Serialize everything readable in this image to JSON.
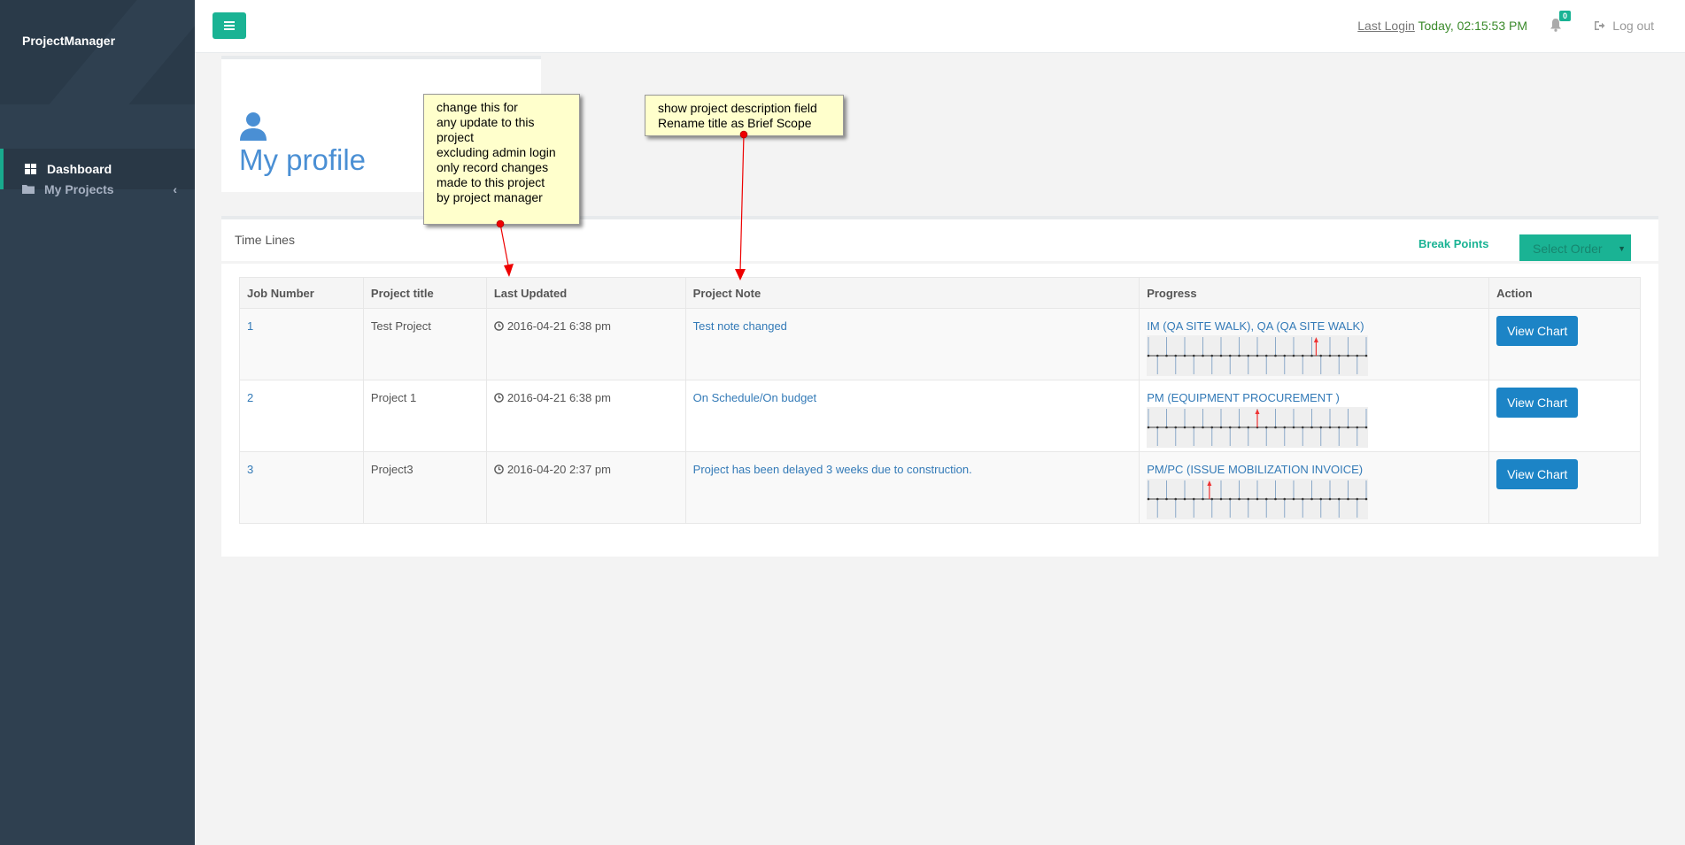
{
  "app": {
    "brand": "ProjectManager"
  },
  "sidebar": {
    "items": [
      {
        "label": "Dashboard",
        "icon": "dashboard-icon",
        "active": true
      },
      {
        "label": "My Projects",
        "icon": "folder-icon",
        "active": false
      }
    ],
    "collapse_icon": "chevron-left-icon"
  },
  "topbar": {
    "menu_icon": "hamburger-icon",
    "last_login_label": "Last Login",
    "last_login_value": "Today, 02:15:53 PM",
    "notification_count": "0",
    "logout_label": "Log out"
  },
  "profile": {
    "title": "My profile",
    "icon": "user-icon"
  },
  "timelines": {
    "title": "Time Lines",
    "break_points_label": "Break Points",
    "select_order_label": "Select Order",
    "columns": [
      "Job Number",
      "Project title",
      "Last Updated",
      "Project Note",
      "Progress",
      "Action"
    ],
    "rows": [
      {
        "job": "1",
        "title": "Test Project",
        "updated": "2016-04-21 6:38 pm",
        "note": "Test note changed",
        "progress": "IM (QA SITE WALK), QA (QA SITE WALK)",
        "action": "View Chart",
        "marker": 0.77
      },
      {
        "job": "2",
        "title": "Project 1",
        "updated": "2016-04-21 6:38 pm",
        "note": "On Schedule/On budget",
        "progress": "PM (EQUIPMENT PROCUREMENT )",
        "action": "View Chart",
        "marker": 0.5
      },
      {
        "job": "3",
        "title": "Project3",
        "updated": "2016-04-20 2:37 pm",
        "note": "Project has been delayed 3 weeks due to construction.",
        "progress": "PM/PC (ISSUE MOBILIZATION INVOICE)",
        "action": "View Chart",
        "marker": 0.28
      }
    ]
  },
  "annotations": [
    {
      "text": "change this for\nany update to this\nproject\nexcluding admin login\nonly record changes\nmade to this project\nby project manager"
    },
    {
      "text": "show project description field\nRename title as Brief Scope"
    }
  ],
  "colors": {
    "accent": "#1ab394",
    "sidebar": "#2f4050",
    "link": "#337ab7",
    "button": "#1c84c6"
  }
}
